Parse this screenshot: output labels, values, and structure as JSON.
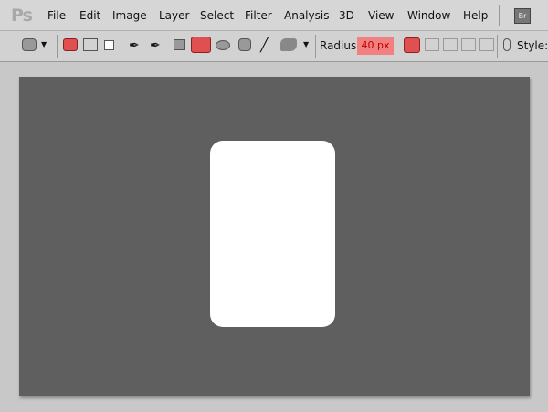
{
  "app": {
    "logo": "Ps"
  },
  "menu": [
    "File",
    "Edit",
    "Image",
    "Layer",
    "Select",
    "Filter",
    "Analysis",
    "3D",
    "View",
    "Window",
    "Help"
  ],
  "bridge_button": "Br",
  "options": {
    "radius_label": "Radius:",
    "radius_value": "40 px",
    "style_label": "Style:"
  },
  "colors": {
    "accent": "#e05050",
    "canvas": "#5f5f5f",
    "shape": "#ffffff"
  }
}
